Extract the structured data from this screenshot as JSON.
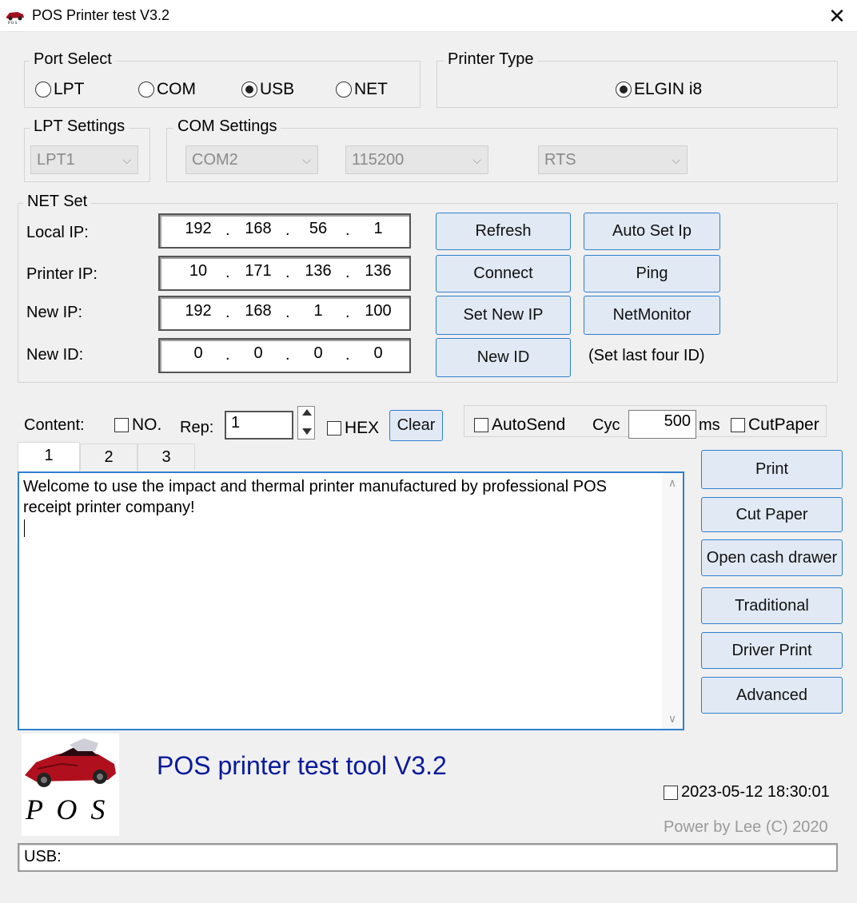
{
  "window": {
    "title": "POS Printer test V3.2",
    "close_glyph": "✕"
  },
  "port_select": {
    "label": "Port Select",
    "options": [
      "LPT",
      "COM",
      "USB",
      "NET"
    ],
    "selected": "USB"
  },
  "printer_type": {
    "label": "Printer Type",
    "option": "ELGIN i8"
  },
  "lpt_settings": {
    "label": "LPT Settings",
    "value": "LPT1"
  },
  "com_settings": {
    "label": "COM Settings",
    "port": "COM2",
    "baud": "115200",
    "flow": "RTS"
  },
  "net_set": {
    "label": "NET Set",
    "rows": [
      {
        "label": "Local IP:",
        "octets": [
          "192",
          "168",
          "56",
          "1"
        ]
      },
      {
        "label": "Printer IP:",
        "octets": [
          "10",
          "171",
          "136",
          "136"
        ]
      },
      {
        "label": "New IP:",
        "octets": [
          "192",
          "168",
          "1",
          "100"
        ]
      },
      {
        "label": "New ID:",
        "octets": [
          "0",
          "0",
          "0",
          "0"
        ]
      }
    ],
    "buttons": {
      "refresh": "Refresh",
      "auto_set_ip": "Auto Set Ip",
      "connect": "Connect",
      "ping": "Ping",
      "set_new_ip": "Set New IP",
      "net_monitor": "NetMonitor",
      "new_id": "New ID"
    },
    "hint": "(Set last four ID)"
  },
  "content_bar": {
    "content_label": "Content:",
    "no_label": "NO.",
    "rep_label": "Rep:",
    "rep_value": "1",
    "hex_label": "HEX",
    "clear_label": "Clear",
    "autosend_label": "AutoSend",
    "cyc_label": "Cyc",
    "cyc_value": "500",
    "ms_label": "ms",
    "cutpaper_label": "CutPaper"
  },
  "tabs": [
    "1",
    "2",
    "3"
  ],
  "content_text": "Welcome to use the impact and thermal printer manufactured by professional POS receipt printer company!",
  "side_buttons": [
    "Print",
    "Cut Paper",
    "Open cash drawer",
    "Traditional",
    "Driver Print",
    "Advanced"
  ],
  "footer": {
    "logo_text": "P O S",
    "app_title": "POS printer test tool V3.2",
    "datetime": "2023-05-12 18:30:01",
    "credit": "Power by Lee (C) 2020",
    "status": "USB:"
  },
  "colors": {
    "accent": "#2f7fcf",
    "title_blue": "#0a1a9a",
    "button_bg": "#e1e9f4"
  }
}
